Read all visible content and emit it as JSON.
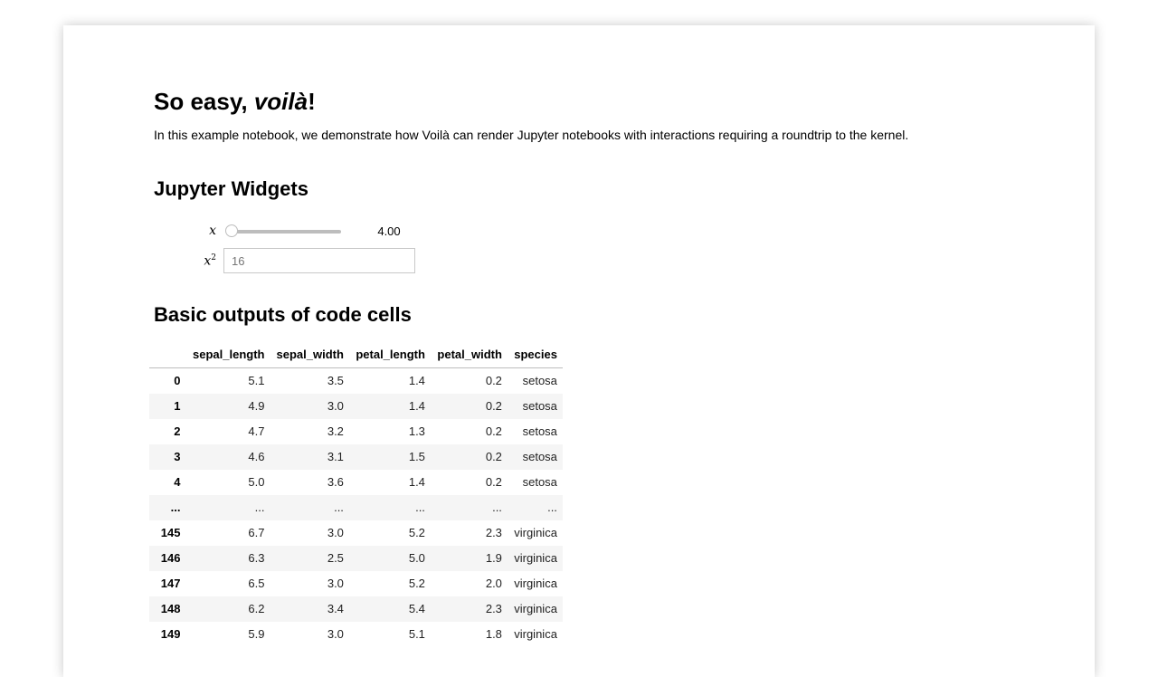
{
  "notebook": {
    "title_prefix": "So easy, ",
    "title_emphasis": "voilà",
    "title_suffix": "!",
    "intro": "In this example notebook, we demonstrate how Voilà can render Jupyter notebooks with interactions requiring a roundtrip to the kernel."
  },
  "widgets_section": {
    "heading": "Jupyter Widgets",
    "slider": {
      "label": "x",
      "readout": "4.00",
      "value_fraction": 0.0
    },
    "text": {
      "label_base": "x",
      "label_sup": "2",
      "placeholder": "16"
    }
  },
  "outputs_section": {
    "heading": "Basic outputs of code cells"
  },
  "dataframe": {
    "columns": [
      "sepal_length",
      "sepal_width",
      "petal_length",
      "petal_width",
      "species"
    ],
    "rows": [
      {
        "index": "0",
        "values": [
          "5.1",
          "3.5",
          "1.4",
          "0.2",
          "setosa"
        ]
      },
      {
        "index": "1",
        "values": [
          "4.9",
          "3.0",
          "1.4",
          "0.2",
          "setosa"
        ]
      },
      {
        "index": "2",
        "values": [
          "4.7",
          "3.2",
          "1.3",
          "0.2",
          "setosa"
        ]
      },
      {
        "index": "3",
        "values": [
          "4.6",
          "3.1",
          "1.5",
          "0.2",
          "setosa"
        ]
      },
      {
        "index": "4",
        "values": [
          "5.0",
          "3.6",
          "1.4",
          "0.2",
          "setosa"
        ]
      },
      {
        "index": "...",
        "values": [
          "...",
          "...",
          "...",
          "...",
          "..."
        ]
      },
      {
        "index": "145",
        "values": [
          "6.7",
          "3.0",
          "5.2",
          "2.3",
          "virginica"
        ]
      },
      {
        "index": "146",
        "values": [
          "6.3",
          "2.5",
          "5.0",
          "1.9",
          "virginica"
        ]
      },
      {
        "index": "147",
        "values": [
          "6.5",
          "3.0",
          "5.2",
          "2.0",
          "virginica"
        ]
      },
      {
        "index": "148",
        "values": [
          "6.2",
          "3.4",
          "5.4",
          "2.3",
          "virginica"
        ]
      },
      {
        "index": "149",
        "values": [
          "5.9",
          "3.0",
          "5.1",
          "1.8",
          "virginica"
        ]
      }
    ]
  }
}
